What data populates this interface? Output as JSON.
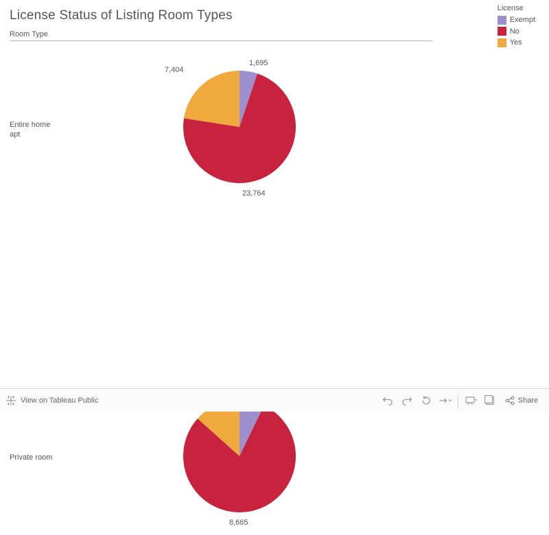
{
  "title": "License Status of Listing Room Types",
  "subheader": "Room Type",
  "legend": {
    "title": "License",
    "items": [
      {
        "label": "Exempt",
        "color": "#9e8fce"
      },
      {
        "label": "No",
        "color": "#c7223e"
      },
      {
        "label": "Yes",
        "color": "#f0a93c"
      }
    ]
  },
  "chart_data": [
    {
      "type": "pie",
      "row_label": "Entire home\napt",
      "series": [
        {
          "name": "Exempt",
          "value": 1695,
          "color": "#9e8fce"
        },
        {
          "name": "No",
          "value": 23764,
          "color": "#c7223e"
        },
        {
          "name": "Yes",
          "value": 7404,
          "color": "#f0a93c"
        }
      ]
    },
    {
      "type": "pie",
      "row_label": "Private room",
      "series": [
        {
          "name": "Exempt",
          "value": 783,
          "color": "#9e8fce"
        },
        {
          "name": "No",
          "value": 8665,
          "color": "#c7223e"
        },
        {
          "name": "Yes",
          "value": 1458,
          "color": "#f0a93c"
        }
      ]
    }
  ],
  "toolbar": {
    "view_label": "View on Tableau Public",
    "share_label": "Share"
  }
}
